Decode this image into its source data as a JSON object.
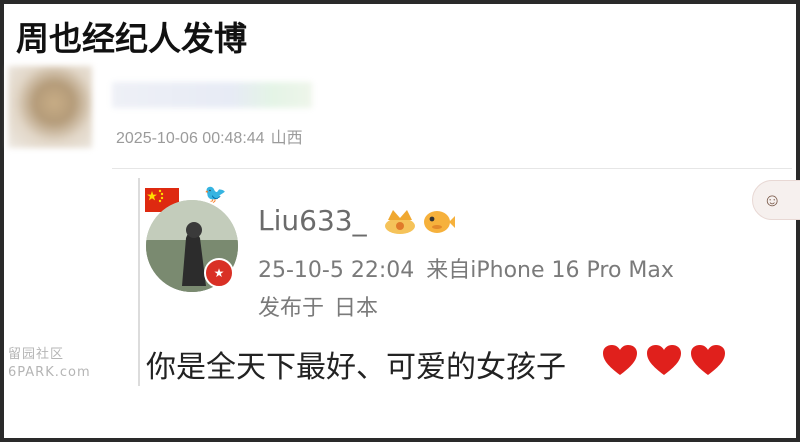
{
  "headline": "周也经纪人发博",
  "top_post": {
    "timestamp": "2025-10-06 00:48:44",
    "region": "山西"
  },
  "quoted_post": {
    "username": "Liu633_",
    "date": "25-10-5 22:04",
    "source": "来自iPhone 16 Pro Max",
    "location_label": "发布于",
    "location": "日本",
    "message": "你是全天下最好、可爱的女孩子",
    "heart_count": 3
  },
  "icons": {
    "flag": "china-flag-icon",
    "bird": "bird-sticker-icon",
    "crown": "crown-badge-icon",
    "fish": "puffer-fish-icon",
    "heart": "red-heart-icon"
  },
  "colors": {
    "heart": "#e0201c",
    "badge": "#d93025"
  },
  "watermark": {
    "line1": "留园社区",
    "line2": "6PARK.com"
  }
}
